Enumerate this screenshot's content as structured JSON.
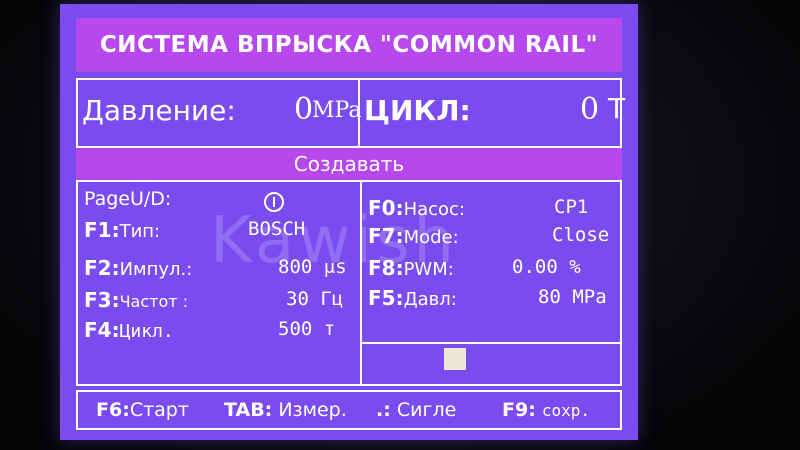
{
  "title": "СИСТЕМА ВПРЫСКА \"COMMON RAIL\"",
  "status": {
    "pressure_label": "Давление:",
    "pressure_value": "0",
    "pressure_unit": "MPa",
    "cycle_label": "ЦИКЛ:",
    "cycle_value": "0",
    "cycle_unit": "T"
  },
  "mode_label": "Создавать",
  "left_params": {
    "page": {
      "label": "PageU/D:",
      "icon": "power-icon"
    },
    "f1": {
      "key": "F1:",
      "label": "Тип:",
      "value": "BOSCH"
    },
    "f2": {
      "key": "F2:",
      "label": "Импул.:",
      "value": "800 μs"
    },
    "f3": {
      "key": "F3:",
      "label": "Частот :",
      "value": "30 Гц"
    },
    "f4": {
      "key": "F4:",
      "label": "Цикл.",
      "value": "500 т"
    }
  },
  "right_params": {
    "f0": {
      "key": "F0:",
      "label": "Насос:",
      "value": "CP1"
    },
    "f7": {
      "key": "F7:",
      "label": "Mode:",
      "value": "Close"
    },
    "f8": {
      "key": "F8:",
      "label": "PWM:",
      "value": "0.00 %"
    },
    "f5": {
      "key": "F5:",
      "label": "Давл:",
      "value": "80 MPa"
    }
  },
  "footer": {
    "f6": {
      "key": "F6:",
      "label": "Старт"
    },
    "tab": {
      "key": "TAB:",
      "label": "Измер."
    },
    "dot": {
      "key": ".:",
      "label": "Сигле"
    },
    "f9": {
      "key": "F9:",
      "label": "сохр."
    }
  },
  "watermark": "Kawish",
  "colors": {
    "screen_bg": "#7a4cf0",
    "highlight_bar": "#b648ee",
    "text": "#ffffff"
  }
}
